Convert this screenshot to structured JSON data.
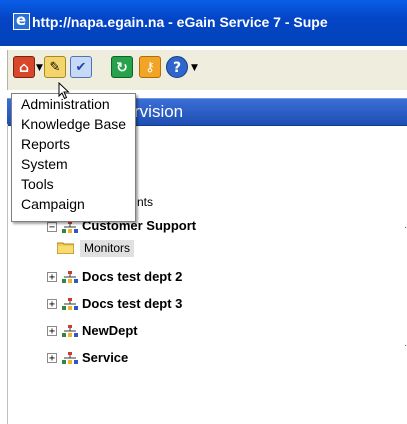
{
  "window": {
    "title": "http://napa.egain.na - eGain Service 7 - Supe"
  },
  "header": {
    "text": "rvision"
  },
  "menu": {
    "items": [
      "Administration",
      "Knowledge Base",
      "Reports",
      "System",
      "Tools",
      "Campaign"
    ]
  },
  "tree": {
    "partial_label": "nts",
    "root": "Customer Support",
    "child": "Monitors",
    "items": [
      "Docs test dept 2",
      "Docs test dept 3",
      "NewDept",
      "Service"
    ]
  },
  "icons": {
    "home": "home-icon",
    "notes": "notes-icon",
    "tasks": "tasks-icon",
    "refresh": "refresh-icon",
    "key": "key-icon",
    "help": "help-icon"
  },
  "colors": {
    "title_bar": "#0445c7",
    "header_bar": "#1d4fb4",
    "toolbar_bg": "#efedde",
    "selection_bg": "#e0e0e0"
  }
}
